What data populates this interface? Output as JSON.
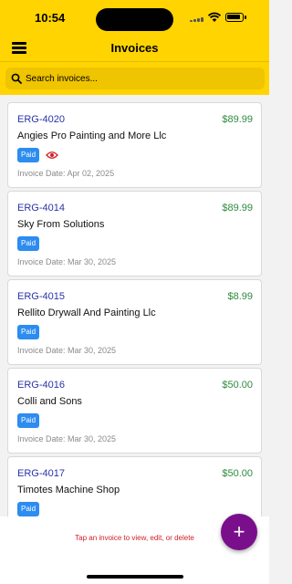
{
  "status_bar": {
    "time": "10:54"
  },
  "header": {
    "title": "Invoices"
  },
  "search": {
    "placeholder": "Search invoices..."
  },
  "invoices": [
    {
      "number": "ERG-4020",
      "amount": "$89.99",
      "customer": "Angies Pro Painting and More Llc",
      "status": "Paid",
      "viewed": true,
      "date": "Invoice Date: Apr 02, 2025"
    },
    {
      "number": "ERG-4014",
      "amount": "$89.99",
      "customer": "Sky From Solutions",
      "status": "Paid",
      "viewed": false,
      "date": "Invoice Date: Mar 30, 2025"
    },
    {
      "number": "ERG-4015",
      "amount": "$8.99",
      "customer": "Rellito Drywall And Painting Llc",
      "status": "Paid",
      "viewed": false,
      "date": "Invoice Date: Mar 30, 2025"
    },
    {
      "number": "ERG-4016",
      "amount": "$50.00",
      "customer": "Colli and Sons",
      "status": "Paid",
      "viewed": false,
      "date": "Invoice Date: Mar 30, 2025"
    },
    {
      "number": "ERG-4017",
      "amount": "$50.00",
      "customer": "Timotes Machine Shop",
      "status": "Paid",
      "viewed": false,
      "date": ""
    }
  ],
  "footer": {
    "hint": "Tap an invoice to view, edit, or delete",
    "fab_label": "+"
  },
  "colors": {
    "header": "#FFD400",
    "search": "#EFC400",
    "invoice_number": "#2a33a8",
    "amount": "#2e8b3e",
    "badge": "#2d8cf0",
    "fab": "#7a0f8c",
    "hint": "#d0202a",
    "viewed_icon": "#d0202a"
  },
  "icons": {
    "menu": "hamburger-icon",
    "search": "search-icon",
    "viewed": "eye-icon",
    "add": "plus-icon"
  }
}
